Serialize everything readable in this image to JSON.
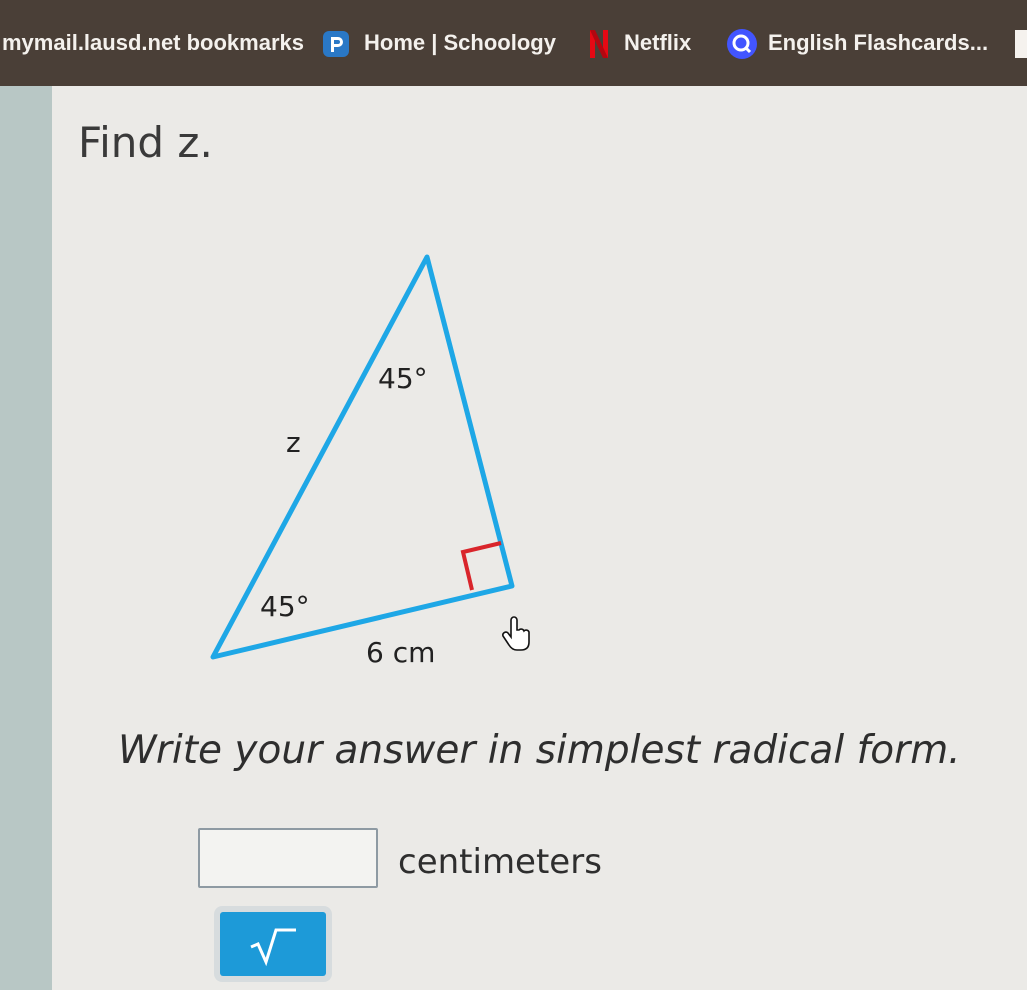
{
  "bookmarks": {
    "items": [
      {
        "label": "mymail.lausd.net bookmarks",
        "icon": "none"
      },
      {
        "label": "Home | Schoology",
        "icon": "schoology-icon"
      },
      {
        "label": "Netflix",
        "icon": "netflix-icon"
      },
      {
        "label": "English Flashcards...",
        "icon": "quizlet-icon"
      }
    ]
  },
  "question": {
    "title": "Find z.",
    "figure": {
      "top_angle": "45°",
      "left_angle": "45°",
      "side_label": "z",
      "base_label": "6 cm"
    },
    "instruction": "Write your answer in simplest radical form.",
    "answer": {
      "value": "",
      "unit": "centimeters"
    },
    "sqrt_button_label": "√"
  },
  "colors": {
    "triangle": "#1ea7e6",
    "right_angle_marker": "#d9252b",
    "button": "#1d9ad8",
    "bookmark_bar": "#4a3f37"
  }
}
